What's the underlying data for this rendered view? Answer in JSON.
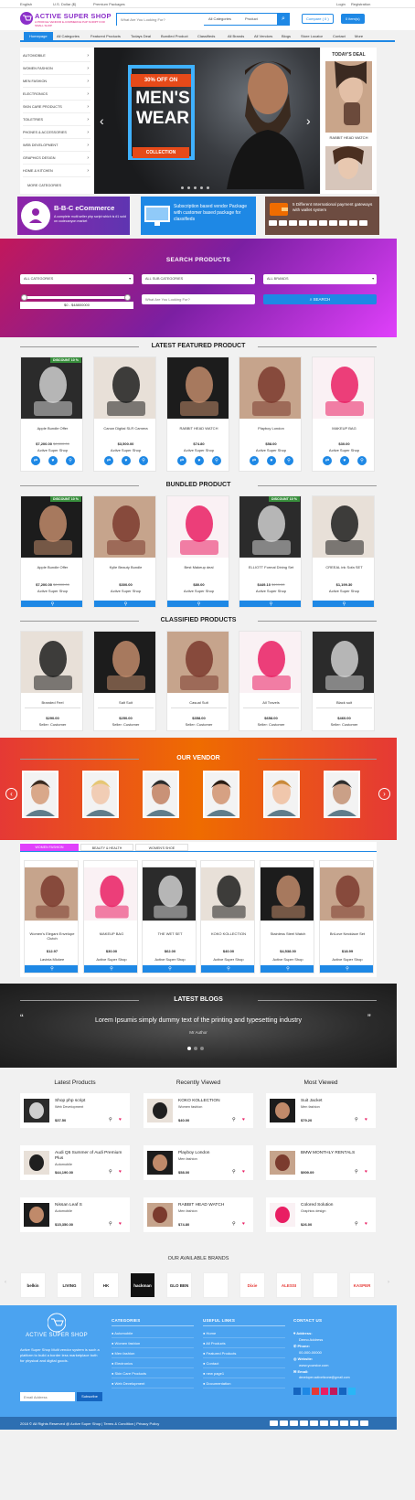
{
  "topbar": {
    "language": "English",
    "currency": "U.S. Dollar ($)",
    "premium": "Premium Packages",
    "login": "Login",
    "register": "Registration"
  },
  "brand": {
    "name": "ACTIVE SUPER SHOP",
    "tagline": "A PROFILE VENDOR E-COMMERCE PHP SCRIPT FOR SMALL SHOP"
  },
  "search": {
    "placeholder": "What Are You Looking For?",
    "category": "All Categories",
    "type": "Product",
    "compare": "Compare ( 0 )",
    "cart": "0 item(s)"
  },
  "nav": [
    "Homepage",
    "All Categories",
    "Featured Products",
    "Todays Deal",
    "Bundled Product",
    "Classifieds",
    "All Brands",
    "All Vendors",
    "Blogs",
    "Store Locator",
    "Contact",
    "More"
  ],
  "categories": [
    "AUTOMOBILE",
    "WOMEN FASHION",
    "MEN FASHION",
    "ELECTRONICS",
    "SKIN CARE PRODUCTS",
    "TOILETRIES",
    "PHONES & ACCESSORIES",
    "WEB DEVELOPMENT",
    "GRAPHICS DESIGN",
    "HOME & KITCHEN"
  ],
  "more_categories": "MORE CATEGORIES",
  "hero": {
    "offer": "30% OFF ON",
    "line1": "MEN'S",
    "line2": "WEAR",
    "collection": "COLLECTION"
  },
  "todays_deal": {
    "title": "TODAY'S DEAL",
    "item": "RABBIT HEAD WATCH"
  },
  "banners": {
    "b1_title": "B-B-C eCommerce",
    "b1_sub": "A complete multi seller php script which is #1 sold on codecanyon market",
    "b2_text": "Subscription based vendor Package with customer based package for classifieds",
    "b3_text": "5 Different International payment gateways with wallet system"
  },
  "search_products": {
    "title": "SEARCH PRODUCTS",
    "all_categories": "ALL CATEGORIES",
    "all_sub": "ALL SUB CATEGORIES",
    "all_brands": "ALL BRANDS",
    "price_range": "$0 - $48800000",
    "placeholder": "What Are You Looking For?",
    "button": "SEARCH"
  },
  "featured": {
    "title": "LATEST FEATURED PRODUCT",
    "items": [
      {
        "name": "Apple Bundle Offer",
        "price": "$7,200.00",
        "old": "$8,800.00",
        "shop": "Active Super Shop",
        "discount": "DISCOUNT 10 %"
      },
      {
        "name": "Canon Digital SLR Camera",
        "price": "$3,500.00",
        "old": "",
        "shop": "Active Super Shop",
        "discount": ""
      },
      {
        "name": "RABBIT HEAD WATCH",
        "price": "$74.80",
        "old": "",
        "shop": "Active Super Shop",
        "discount": ""
      },
      {
        "name": "Playboy London",
        "price": "$58.00",
        "old": "",
        "shop": "Active Super Shop",
        "discount": ""
      },
      {
        "name": "MAKEUP BAG",
        "price": "$30.00",
        "old": "",
        "shop": "Active Super Shop",
        "discount": ""
      }
    ]
  },
  "bundled": {
    "title": "BUNDLED PRODUCT",
    "items": [
      {
        "name": "Apple Bundle Offer",
        "price": "$7,200.00",
        "old": "$8,000.00",
        "shop": "Active Super Shop",
        "discount": "DISCOUNT 10 %"
      },
      {
        "name": "Kylie Beauty Bundle",
        "price": "$300.00",
        "old": "",
        "shop": "Active Super Shop",
        "discount": ""
      },
      {
        "name": "Best Makeup deal",
        "price": "$80.00",
        "old": "",
        "shop": "Active Super Shop",
        "discount": ""
      },
      {
        "name": "ELLIOTT Formal Dining Set",
        "price": "$449.10",
        "old": "$499.00",
        "shop": "Active Super Shop",
        "discount": "DISCOUNT 10 %"
      },
      {
        "name": "CREEAL ink Sofa SET",
        "price": "$1,199.30",
        "old": "",
        "shop": "Active Super Shop",
        "discount": ""
      }
    ]
  },
  "classified": {
    "title": "CLASSIFIED PRODUCTS",
    "items": [
      {
        "name": "Branded Feel",
        "price": "$290.00",
        "shop": "Seller: Customer"
      },
      {
        "name": "Salt Suit",
        "price": "$250.00",
        "shop": "Seller: Customer"
      },
      {
        "name": "Casual Suit",
        "price": "$358.00",
        "shop": "Seller: Customer"
      },
      {
        "name": "All Travels",
        "price": "$658.00",
        "shop": "Seller: Customer"
      },
      {
        "name": "Black suit",
        "price": "$460.00",
        "shop": "Seller: Customer"
      }
    ]
  },
  "vendor": {
    "title": "OUR VENDOR"
  },
  "tabs": {
    "items": [
      "WOMEN FASHION",
      "BEAUTY & HEALTH",
      "WOMEN'S SHOE"
    ],
    "products": [
      {
        "name": "Women's Elegant Envelope Clutch",
        "price": "$12.97",
        "shop": "Lavinia Mickee"
      },
      {
        "name": "MAKEUP BAG",
        "price": "$30.00",
        "shop": "Active Super Shop"
      },
      {
        "name": "THE WET SET",
        "price": "$62.00",
        "shop": "Active Super Shop"
      },
      {
        "name": "KOKO KOLLECTION",
        "price": "$40.00",
        "shop": "Active Super Shop"
      },
      {
        "name": "Stainless Steel Watch",
        "price": "$4,538.00",
        "shop": "Active Super Shop"
      },
      {
        "name": "BriLove Necklace Set",
        "price": "$18.99",
        "shop": "Active Super Shop"
      }
    ]
  },
  "blogs": {
    "title": "LATEST BLOGS",
    "quote": "Lorem Ipsumis simply dummy text of the printing and typesetting industry",
    "author": "Mr Author"
  },
  "lists": {
    "latest": {
      "title": "Latest Products",
      "items": [
        {
          "name": "Shop php script",
          "cat": "Web Development",
          "price": "$37.50"
        },
        {
          "name": "Audi Q5 Summer of Audi Premium Plus",
          "cat": "Automobile",
          "price": "$44,190.00"
        },
        {
          "name": "Nissan Leaf S",
          "cat": "Automobile",
          "price": "$15,350.00"
        }
      ]
    },
    "recent": {
      "title": "Recently Viewed",
      "items": [
        {
          "name": "KOKO KOLLECTION",
          "cat": "Women fashion",
          "price": "$40.00"
        },
        {
          "name": "Playboy London",
          "cat": "Men fashion",
          "price": "$58.00"
        },
        {
          "name": "RABBIT HEAD WATCH",
          "cat": "Men fashion",
          "price": "$74.80"
        }
      ]
    },
    "most": {
      "title": "Most Viewed",
      "items": [
        {
          "name": "Suit Jacket",
          "cat": "Men fashion",
          "price": "$79.20"
        },
        {
          "name": "BMW MONTHLY RENTALS",
          "cat": "",
          "price": "$909.09"
        },
        {
          "name": "Colored Solution",
          "cat": "Graphics design",
          "price": "$26.00"
        }
      ]
    }
  },
  "brands": {
    "title": "OUR AVAILABLE BRANDS",
    "items": [
      "belkin",
      "LIVING",
      "HK",
      "hackman",
      "GLO BEN",
      "",
      "Dixie",
      "ALESSI",
      "",
      "KASPER"
    ]
  },
  "footer": {
    "brand": "ACTIVE SUPER SHOP",
    "about": "Active Super Shop Multi vendor system is such a platform to build a border less marketplace both for physical and digital goods.",
    "subscribe_placeholder": "Email Address",
    "subscribe_btn": "Subscribe",
    "categories_title": "CATEGORIES",
    "categories": [
      "Automobile",
      "Women fashion",
      "Men fashion",
      "Electronics",
      "Skin Care Products",
      "Web Development"
    ],
    "links_title": "USEFUL LINKS",
    "links": [
      "Home",
      "All Products",
      "Featured Products",
      "Contact",
      "new page1",
      "Documentation"
    ],
    "contact_title": "CONTACT US",
    "address_label": "Address:",
    "address": "Demo Address",
    "phone_label": "Phone:",
    "phone": "00-000-00000",
    "website_label": "Website:",
    "website": "www.yourstor.com",
    "email_label": "Email:",
    "email": "developer.activeitzone@gmail.com",
    "copyright": "2018 © All Rights Reserved @ Active Super Shop | Terms & Condition | Privacy Policy"
  },
  "colors": {
    "primary": "#1e88e5",
    "accent": "#e64a19",
    "purple": "#8e24aa"
  }
}
